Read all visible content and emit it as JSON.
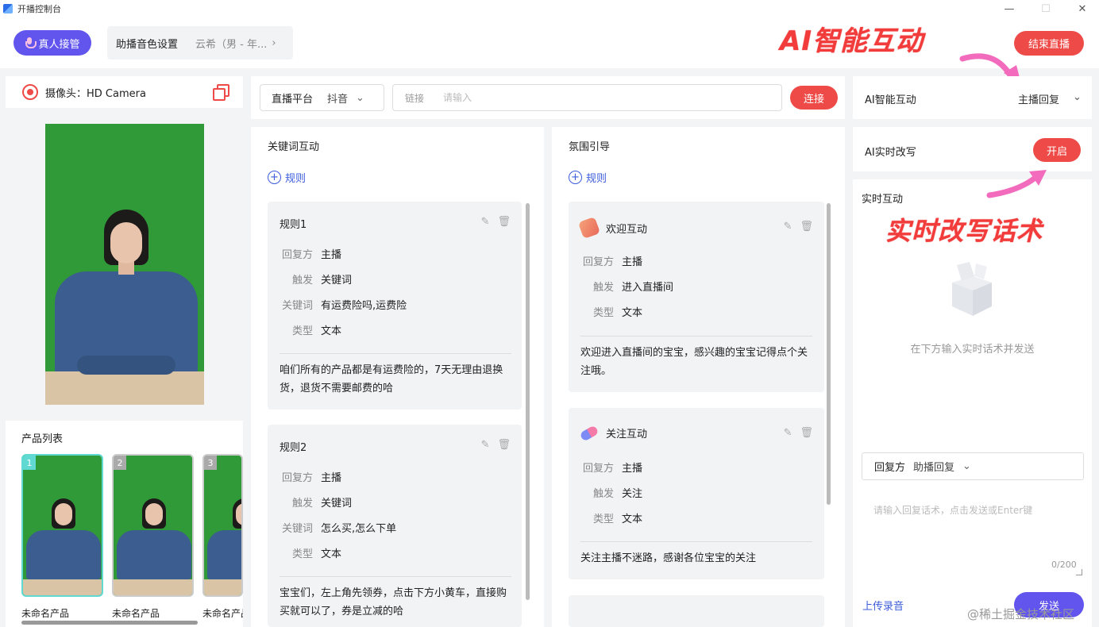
{
  "window": {
    "title": "开播控制台",
    "minimize": "—",
    "maximize": "☐",
    "close": "✕"
  },
  "topbar": {
    "takeover_label": "真人接管",
    "voice_label": "助播音色设置",
    "voice_value": "云希（男 - 年...",
    "banner_ai": "AI智能互动",
    "end_live_label": "结束直播"
  },
  "camera": {
    "label": "摄像头：HD Camera"
  },
  "products": {
    "title": "产品列表",
    "items": [
      {
        "num": "1",
        "name": "未命名产品"
      },
      {
        "num": "2",
        "name": "未命名产品"
      },
      {
        "num": "3",
        "name": "未命名产品"
      }
    ]
  },
  "platform": {
    "label": "直播平台",
    "value": "抖音",
    "link_label": "链接",
    "link_placeholder": "请输入",
    "connect_label": "连接"
  },
  "keyword": {
    "title": "关键词互动",
    "add_label": "规则",
    "rules": [
      {
        "title": "规则1",
        "reply_k": "回复方",
        "reply_v": "主播",
        "trigger_k": "触发",
        "trigger_v": "关键词",
        "kw_k": "关键词",
        "kw_v": "有运费险吗,运费险",
        "type_k": "类型",
        "type_v": "文本",
        "text": "咱们所有的产品都是有运费险的，7天无理由退换货，退货不需要邮费的哈"
      },
      {
        "title": "规则2",
        "reply_k": "回复方",
        "reply_v": "主播",
        "trigger_k": "触发",
        "trigger_v": "关键词",
        "kw_k": "关键词",
        "kw_v": "怎么买,怎么下单",
        "type_k": "类型",
        "type_v": "文本",
        "text": "宝宝们，左上角先领券，点击下方小黄车，直接购买就可以了，券是立减的哈"
      }
    ]
  },
  "atmosphere": {
    "title": "氛围引导",
    "add_label": "规则",
    "rules": [
      {
        "title": "欢迎互动",
        "reply_k": "回复方",
        "reply_v": "主播",
        "trigger_k": "触发",
        "trigger_v": "进入直播间",
        "type_k": "类型",
        "type_v": "文本",
        "text": "欢迎进入直播间的宝宝，感兴趣的宝宝记得点个关注哦。"
      },
      {
        "title": "关注互动",
        "reply_k": "回复方",
        "reply_v": "主播",
        "trigger_k": "触发",
        "trigger_v": "关注",
        "type_k": "类型",
        "type_v": "文本",
        "text": "关注主播不迷路，感谢各位宝宝的关注"
      }
    ]
  },
  "ai": {
    "mode_label": "AI智能互动",
    "mode_value": "主播回复",
    "rewrite_label": "AI实时改写",
    "rewrite_btn": "开启",
    "live_label": "实时互动",
    "banner_rewrite": "实时改写话术",
    "empty_hint": "在下方输入实时话术并发送",
    "reply_k": "回复方",
    "reply_v": "助播回复",
    "input_placeholder": "请输入回复话术，点击发送或Enter键",
    "char_count": "0/200",
    "upload_label": "上传录音",
    "send_label": "发送"
  },
  "watermark": "@稀土掘金技术社区",
  "colors": {
    "primary": "#6155ee",
    "danger": "#ee4b48",
    "link": "#3b5bdb",
    "feed_green": "#2f9a37"
  }
}
